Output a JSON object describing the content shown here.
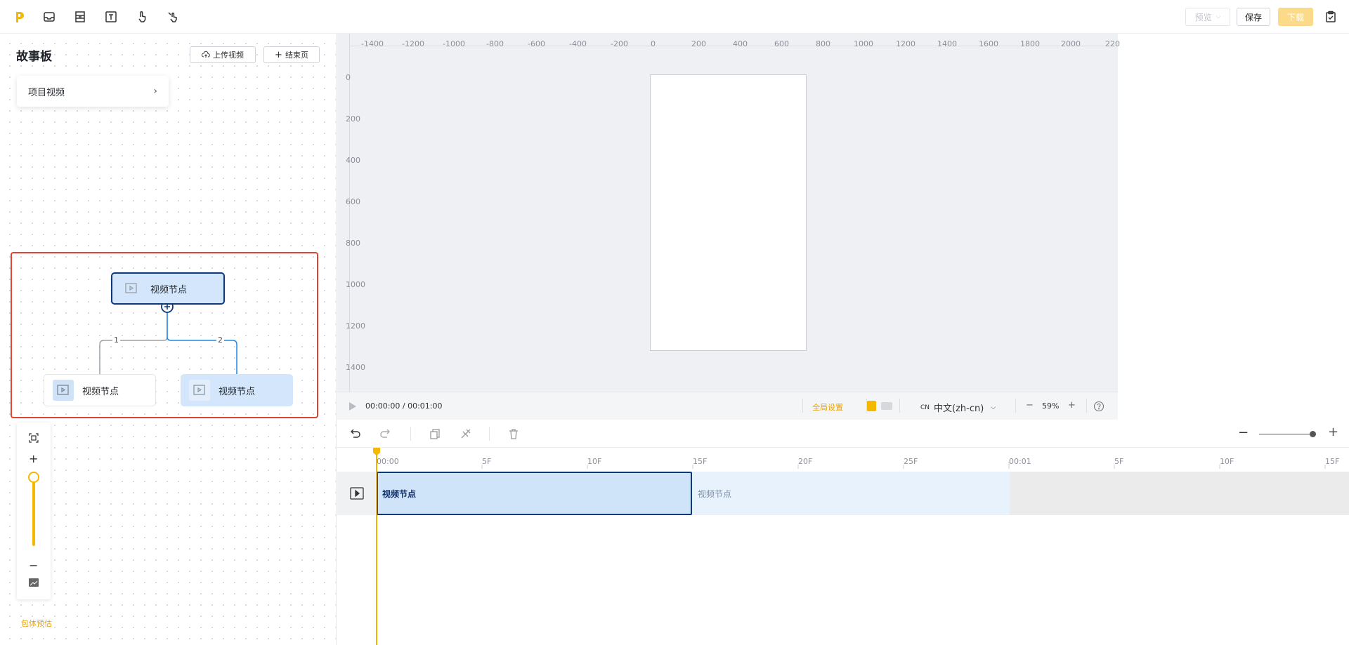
{
  "topbar": {
    "tools": [
      "inbox-icon",
      "layout-icon",
      "text-icon",
      "hand-pointer-icon",
      "gesture-icon"
    ],
    "preview_label": "预览",
    "save_label": "保存",
    "download_label": "下载",
    "accent": "#f5b800"
  },
  "storyboard": {
    "title": "故事板",
    "upload_label": "上传视频",
    "end_page_label": "结束页",
    "project_video_label": "项目视频",
    "nodes": {
      "root": "视频节点",
      "left": "视频节点",
      "right": "视频节点"
    },
    "edge_labels": [
      "1",
      "2"
    ],
    "footnote": "包体预估"
  },
  "canvas": {
    "ruler_x": [
      "-1400",
      "-1200",
      "-1000",
      "-800",
      "-600",
      "-400",
      "-200",
      "0",
      "200",
      "400",
      "600",
      "800",
      "1000",
      "1200",
      "1400",
      "1600",
      "1800",
      "2000",
      "220"
    ],
    "ruler_y": [
      "0",
      "200",
      "400",
      "600",
      "800",
      "1000",
      "1200",
      "1400"
    ],
    "time": "00:00:00 / 00:01:00",
    "global_settings": "全局设置",
    "lang_prefix": "CN",
    "language": "中文(zh-cn)",
    "zoom": "59%",
    "zoom_minus": "−",
    "zoom_plus": "+"
  },
  "timeline": {
    "ticks": [
      "00:00",
      "5F",
      "10F",
      "15F",
      "20F",
      "25F",
      "00:01",
      "5F",
      "10F",
      "15F"
    ],
    "clip1_label": "视频节点",
    "clip2_label": "视频节点"
  }
}
